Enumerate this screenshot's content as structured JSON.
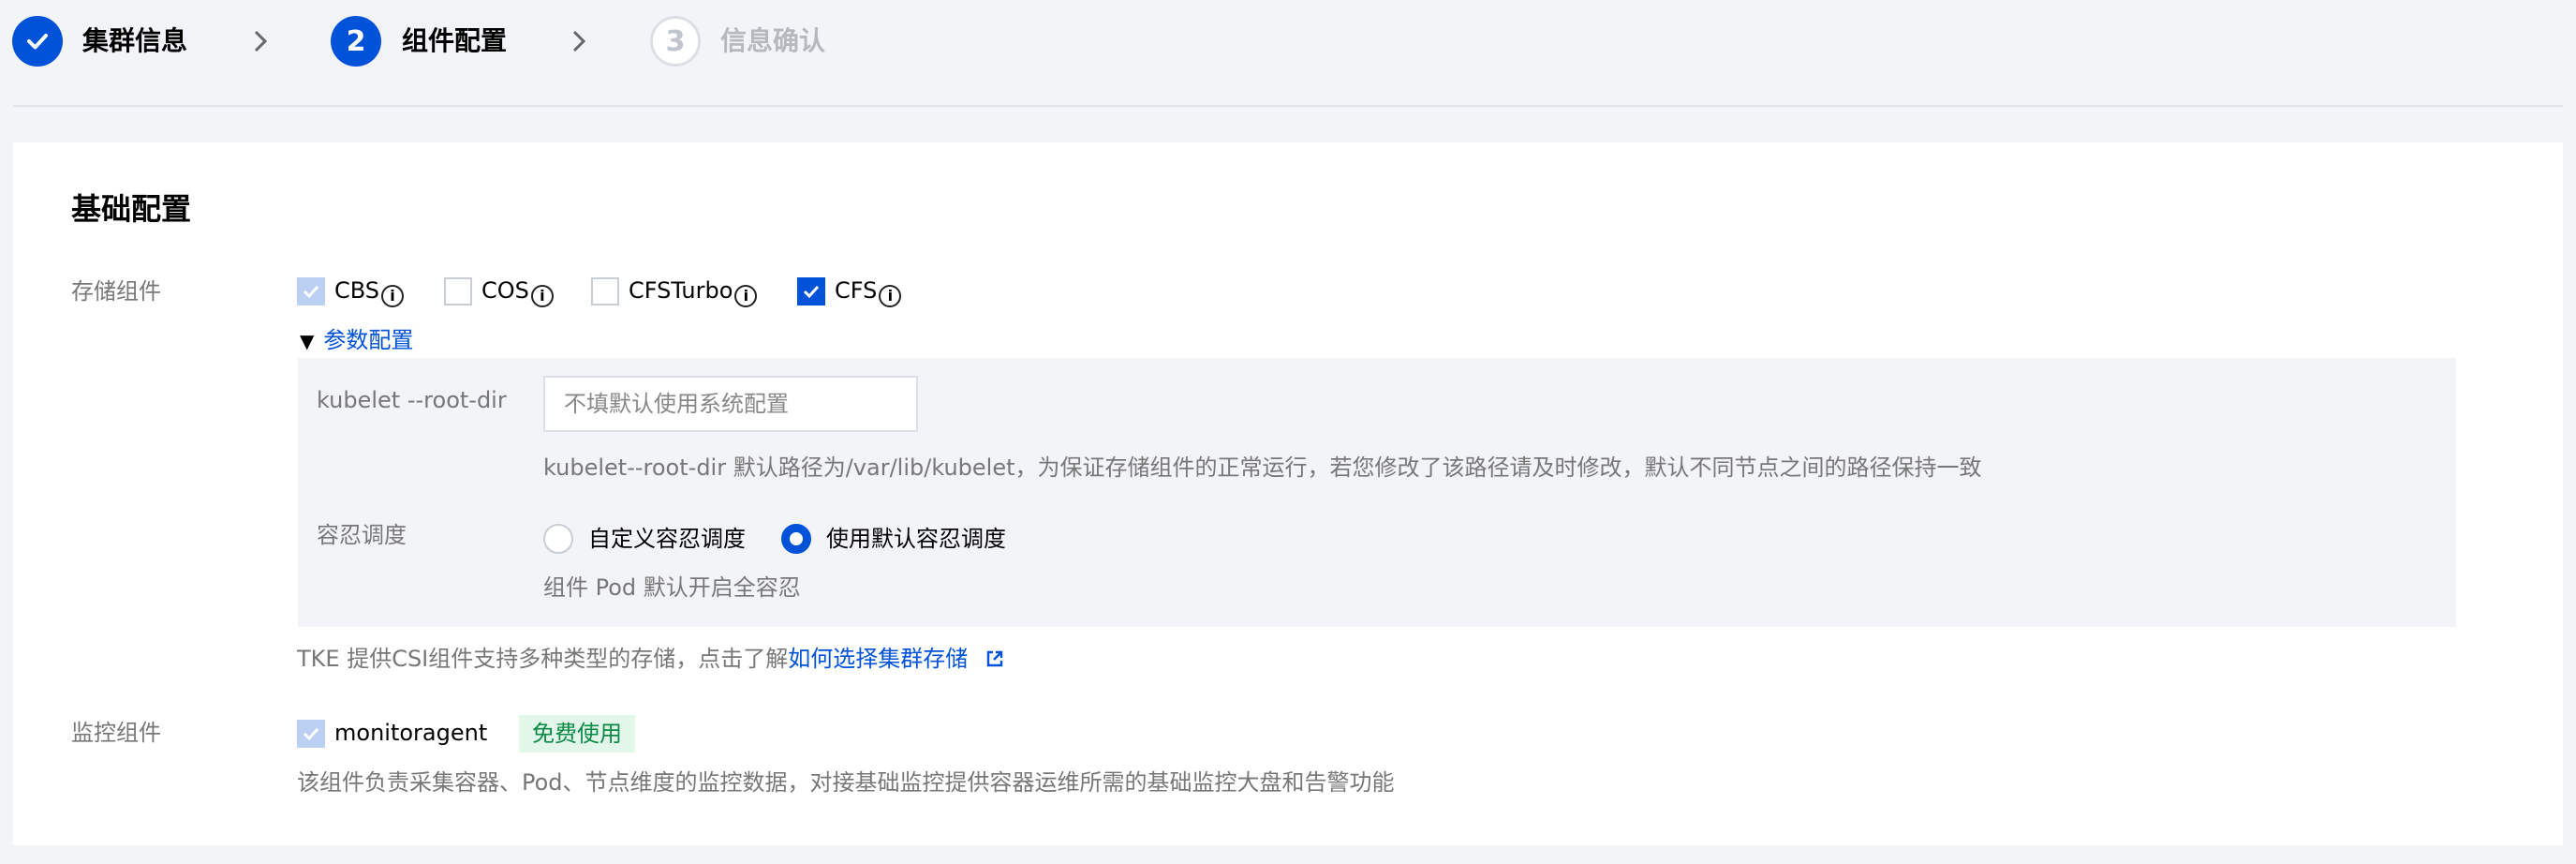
{
  "steps": [
    {
      "number": "",
      "label": "集群信息",
      "state": "done"
    },
    {
      "number": "2",
      "label": "组件配置",
      "state": "active"
    },
    {
      "number": "3",
      "label": "信息确认",
      "state": "pending"
    }
  ],
  "basic": {
    "title": "基础配置",
    "storage": {
      "label": "存储组件",
      "options": [
        {
          "label": "CBS",
          "state": "checked-disabled"
        },
        {
          "label": "COS",
          "state": "unchecked"
        },
        {
          "label": "CFSTurbo",
          "state": "unchecked"
        },
        {
          "label": "CFS",
          "state": "checked"
        }
      ],
      "params_toggle": "参数配置",
      "kubelet": {
        "label": "kubelet --root-dir",
        "placeholder": "不填默认使用系统配置",
        "hint": "kubelet--root-dir 默认路径为/var/lib/kubelet，为保证存储组件的正常运行，若您修改了该路径请及时修改，默认不同节点之间的路径保持一致"
      },
      "toleration": {
        "label": "容忍调度",
        "options": [
          "自定义容忍调度",
          "使用默认容忍调度"
        ],
        "selected": "使用默认容忍调度",
        "hint": "组件 Pod 默认开启全容忍"
      },
      "csi_note_prefix": "TKE 提供CSI组件支持多种类型的存储，点击了解",
      "csi_note_link": "如何选择集群存储"
    },
    "monitor": {
      "label": "监控组件",
      "option": "monitoragent",
      "badge": "免费使用",
      "description": "该组件负责采集容器、Pod、节点维度的监控数据，对接基础监控提供容器运维所需的基础监控大盘和告警功能"
    }
  },
  "colors": {
    "primary": "#0052d9",
    "badge_bg": "#e3f6ea",
    "badge_text": "#0a8a45"
  }
}
